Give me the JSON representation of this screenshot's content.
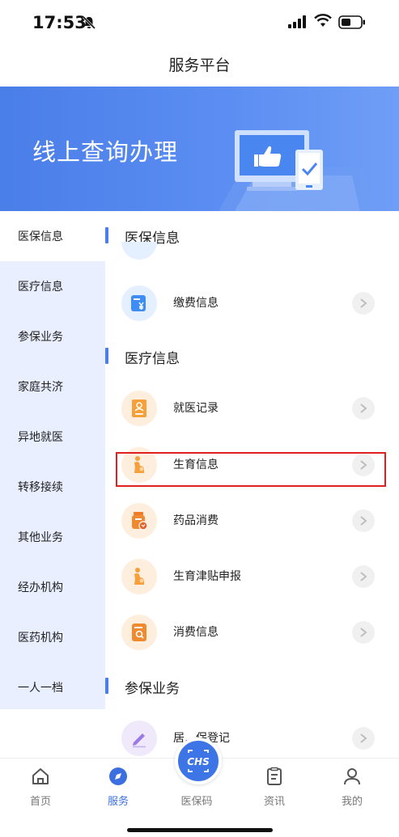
{
  "status": {
    "time": "17:53"
  },
  "nav": {
    "title": "服务平台"
  },
  "banner": {
    "text": "线上查询办理"
  },
  "sidebar": {
    "items": [
      {
        "label": "医保信息"
      },
      {
        "label": "医疗信息"
      },
      {
        "label": "参保业务"
      },
      {
        "label": "家庭共济"
      },
      {
        "label": "异地就医"
      },
      {
        "label": "转移接续"
      },
      {
        "label": "其他业务"
      },
      {
        "label": "经办机构"
      },
      {
        "label": "医药机构"
      },
      {
        "label": "一人一档"
      }
    ],
    "active_index": 0
  },
  "content": {
    "section_yibao": {
      "title": "医保信息"
    },
    "row_jiaofei": {
      "label": "缴费信息",
      "icon": "payment-icon"
    },
    "section_yiliao": {
      "title": "医疗信息"
    },
    "row_jiuyi": {
      "label": "就医记录",
      "icon": "medical-record-icon"
    },
    "row_shengyu": {
      "label": "生育信息",
      "icon": "maternity-icon"
    },
    "row_yaopin": {
      "label": "药品消费",
      "icon": "medicine-icon"
    },
    "row_jintie": {
      "label": "生育津贴申报",
      "icon": "maternity-allowance-icon"
    },
    "row_xiaofei": {
      "label": "消费信息",
      "icon": "consumption-icon"
    },
    "section_canbao": {
      "title": "参保业务"
    },
    "row_dengji": {
      "label": "居…保登记",
      "icon": "edit-icon"
    }
  },
  "tabbar": {
    "items": [
      {
        "label": "首页",
        "icon": "home-icon"
      },
      {
        "label": "服务",
        "icon": "compass-icon",
        "active": true
      },
      {
        "label": "医保码",
        "icon": "chs-logo-icon"
      },
      {
        "label": "资讯",
        "icon": "clipboard-icon"
      },
      {
        "label": "我的",
        "icon": "profile-icon"
      }
    ]
  },
  "colors": {
    "accent": "#3b6fe0",
    "banner": "#4a7ee8",
    "sidebar_bg": "#e9efff",
    "highlight_box": "#e02020"
  }
}
